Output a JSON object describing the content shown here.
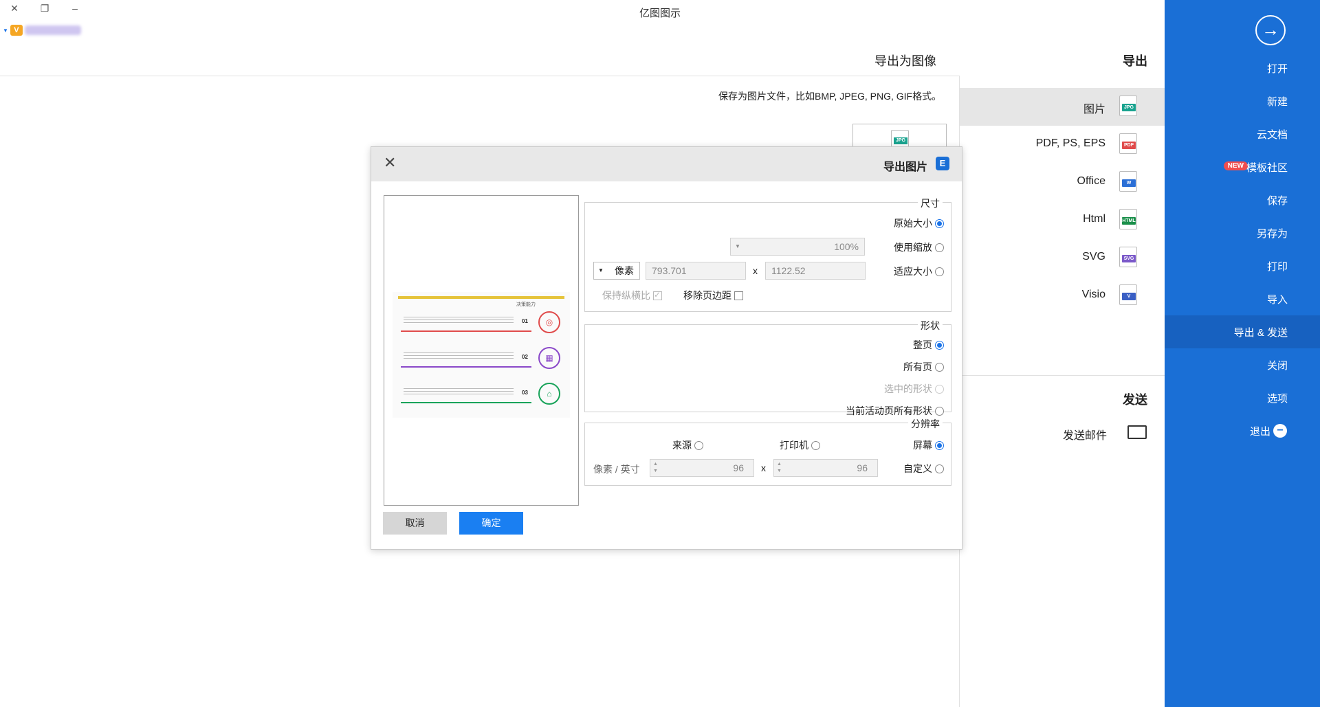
{
  "window": {
    "title": "亿图图示",
    "controls": [
      "✕",
      "❐",
      "–"
    ],
    "vip_icon": "V"
  },
  "sidebar": {
    "back_icon": "→",
    "items": [
      {
        "label": "打开"
      },
      {
        "label": "新建"
      },
      {
        "label": "云文档"
      },
      {
        "label": "模板社区",
        "badge": "NEW"
      },
      {
        "label": "保存"
      },
      {
        "label": "另存为"
      },
      {
        "label": "打印"
      },
      {
        "label": "导入"
      },
      {
        "label": "导出 & 发送",
        "active": true
      },
      {
        "label": "关闭"
      },
      {
        "label": "选项"
      },
      {
        "label": "退出",
        "icon": "−"
      }
    ],
    "color": "#1a6fd6",
    "active_color": "#1761c0"
  },
  "export_panel": {
    "title": "导出",
    "items": [
      {
        "label": "图片",
        "tag": "JPG",
        "tag_color": "#19a38f"
      },
      {
        "label": "PDF, PS, EPS",
        "tag": "PDF",
        "tag_color": "#e04b4b"
      },
      {
        "label": "Office",
        "tag": "W",
        "tag_color": "#2b6fd6"
      },
      {
        "label": "Html",
        "tag": "HTML",
        "tag_color": "#1a8f4a"
      },
      {
        "label": "SVG",
        "tag": "SVG",
        "tag_color": "#7b59c9"
      },
      {
        "label": "Visio",
        "tag": "V",
        "tag_color": "#3a5fc4"
      }
    ],
    "send_title": "发送",
    "send_items": [
      {
        "label": "发送邮件"
      }
    ]
  },
  "export_image": {
    "title": "导出为图像",
    "description": "保存为图片文件，比如BMP, JPEG, PNG, GIF格式。",
    "thumb_tag": "JPG"
  },
  "dialog": {
    "title": "导出图片",
    "logo": "E",
    "close_icon": "✕",
    "size_group": {
      "legend": "尺寸",
      "original_size": "原始大小",
      "use_zoom": "使用缩放",
      "zoom_value": "100%",
      "fit_size": "适应大小",
      "width": "1122.52",
      "height": "793.701",
      "times": "x",
      "unit": "像素",
      "remove_margin": "移除页边距",
      "keep_ratio": "保持纵横比"
    },
    "shape_group": {
      "legend": "形状",
      "whole_page": "整页",
      "all_pages": "所有页",
      "selected_shapes": "选中的形状",
      "current_page_shapes": "当前活动页所有形状"
    },
    "resolution_group": {
      "legend": "分辨率",
      "screen": "屏幕",
      "printer": "打印机",
      "source": "来源",
      "custom": "自定义",
      "dpi_x": "96",
      "dpi_y": "96",
      "times": "x",
      "unit": "像素 / 英寸"
    },
    "ok_button": "确定",
    "cancel_button": "取消",
    "preview": {
      "title": "决策能力",
      "rows": [
        {
          "num": "01",
          "color": "#e04b4b"
        },
        {
          "num": "02",
          "color": "#8a48c9"
        },
        {
          "num": "03",
          "color": "#19a35a"
        }
      ]
    }
  }
}
